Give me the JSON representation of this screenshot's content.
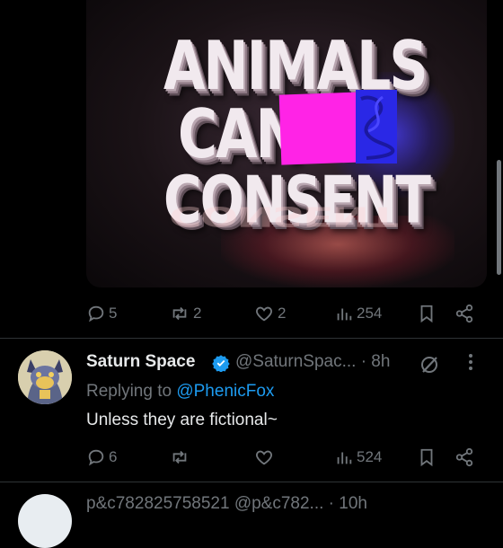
{
  "media": {
    "line1": "ANIMALS",
    "line2": "CAN",
    "line3": "CONSENT",
    "reflection": "CONSENT"
  },
  "tweet1_actions": {
    "replies": "5",
    "reposts": "2",
    "likes": "2",
    "views": "254"
  },
  "reply": {
    "name": "Saturn Space",
    "handle": "@SaturnSpac...",
    "time": "· 8h",
    "replying_prefix": "Replying to ",
    "replying_to": "@PhenicFox",
    "text": "Unless they are fictional~",
    "actions": {
      "replies": "6",
      "reposts": "",
      "likes": "",
      "views": "524"
    }
  },
  "next": {
    "line": "p&c782825758521 @p&c782... · 10h"
  },
  "colors": {
    "background": "#000000",
    "muted": "#71767b",
    "link": "#1d9bf0",
    "verified": "#1d9bf0"
  }
}
